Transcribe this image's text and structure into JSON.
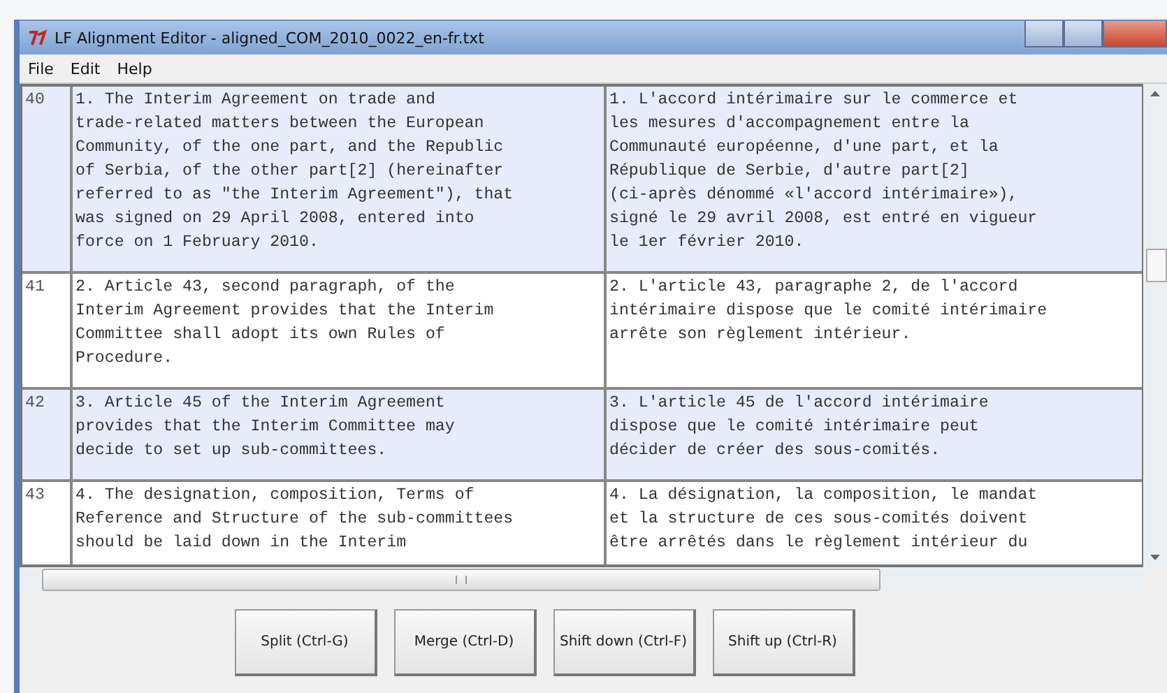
{
  "window": {
    "title": "LF Alignment Editor - aligned_COM_2010_0022_en-fr.txt"
  },
  "menu": [
    "File",
    "Edit",
    "Help"
  ],
  "rows": [
    {
      "number": "40",
      "highlighted": true,
      "source": "1. The Interim Agreement on trade and\ntrade-related matters between the European\nCommunity, of the one part, and the Republic\nof Serbia, of the other part[2] (hereinafter\nreferred to as \"the Interim Agreement\"), that\nwas signed on 29 April 2008, entered into\nforce on 1 February 2010.",
      "target": "1. L'accord intérimaire sur le commerce et\nles mesures d'accompagnement entre la\nCommunauté européenne, d'une part, et la\nRépublique de Serbie, d'autre part[2]\n(ci-après dénommé «l'accord intérimaire»),\nsigné le 29 avril 2008, est entré en vigueur\nle 1er février 2010."
    },
    {
      "number": "41",
      "highlighted": false,
      "source": "2. Article 43, second paragraph, of the\nInterim Agreement provides that the Interim\nCommittee shall adopt its own Rules of\nProcedure.",
      "target": "2. L'article 43, paragraphe 2, de l'accord\nintérimaire dispose que le comité intérimaire\narrête son règlement intérieur."
    },
    {
      "number": "42",
      "highlighted": true,
      "source": "3. Article 45 of the Interim Agreement\nprovides that the Interim Committee may\ndecide to set up sub-committees.",
      "target": "3. L'article 45 de l'accord intérimaire\ndispose que le comité intérimaire peut\ndécider de créer des sous-comités."
    },
    {
      "number": "43",
      "highlighted": false,
      "source": "4. The designation, composition, Terms of\nReference and Structure of the sub-committees\nshould be laid down in the Interim",
      "target": "4. La désignation, la composition, le mandat\net la structure de ces sous-comités doivent\nêtre arrêtés dans le règlement intérieur du"
    }
  ],
  "buttons": [
    "Split (Ctrl-G)",
    "Merge (Ctrl-D)",
    "Shift down (Ctrl-F)",
    "Shift up (Ctrl-R)"
  ]
}
